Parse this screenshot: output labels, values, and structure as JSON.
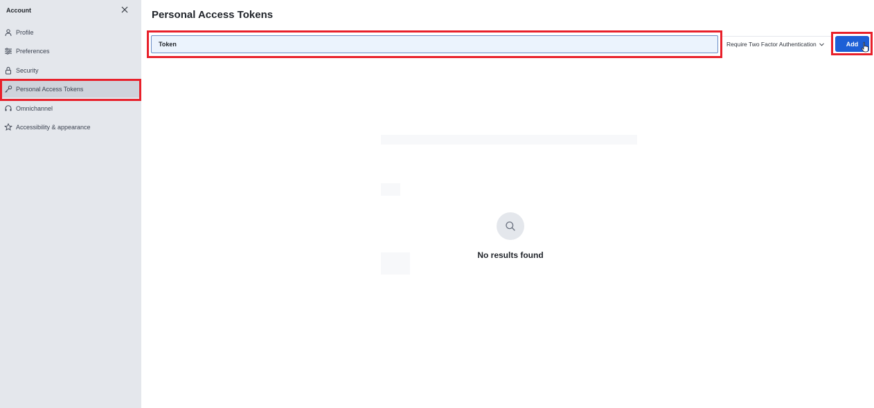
{
  "sidebar": {
    "title": "Account",
    "items": [
      {
        "label": "Profile",
        "icon": "user-icon"
      },
      {
        "label": "Preferences",
        "icon": "sliders-icon"
      },
      {
        "label": "Security",
        "icon": "lock-icon"
      },
      {
        "label": "Personal Access Tokens",
        "icon": "key-icon",
        "active": true
      },
      {
        "label": "Omnichannel",
        "icon": "headset-icon"
      },
      {
        "label": "Accessibility & appearance",
        "icon": "accessibility-icon"
      }
    ]
  },
  "main": {
    "title": "Personal Access Tokens",
    "token_input": {
      "value": "Token"
    },
    "two_factor_select": {
      "label": "Require Two Factor Authentication"
    },
    "add_label": "Add",
    "empty_state": {
      "text": "No results found",
      "icon": "search-icon"
    }
  },
  "colors": {
    "highlight": "#e8202a",
    "primary": "#1d5fd6",
    "sidebar_bg": "#e4e7ec",
    "input_bg": "#ebf3fd"
  }
}
